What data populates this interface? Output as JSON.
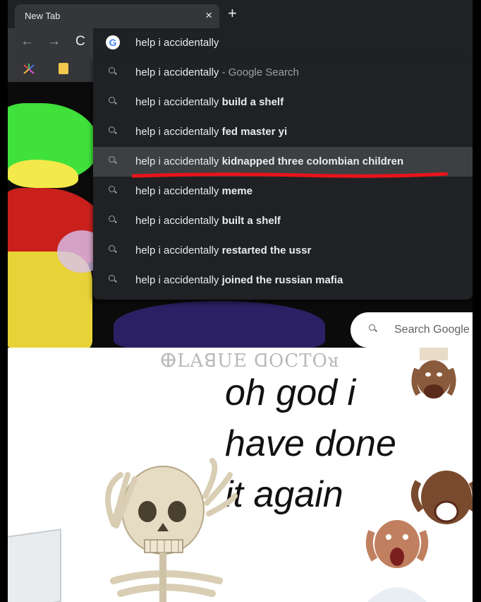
{
  "browser": {
    "tab_title": "New Tab",
    "tab_close": "×",
    "new_tab": "+",
    "nav_back": "←",
    "nav_forward": "→",
    "nav_reload": "C",
    "omnibox_value": "help i accidentally",
    "suggestions": [
      {
        "prefix": "help i accidentally",
        "bold": "",
        "suffix": " - Google Search"
      },
      {
        "prefix": "help i accidentally ",
        "bold": "build a shelf",
        "suffix": ""
      },
      {
        "prefix": "help i accidentally ",
        "bold": "fed master yi",
        "suffix": ""
      },
      {
        "prefix": "help i accidentally ",
        "bold": "kidnapped three colombian children",
        "suffix": ""
      },
      {
        "prefix": "help i accidentally ",
        "bold": "meme",
        "suffix": ""
      },
      {
        "prefix": "help i accidentally ",
        "bold": "built a shelf",
        "suffix": ""
      },
      {
        "prefix": "help i accidentally ",
        "bold": "restarted the ussr",
        "suffix": ""
      },
      {
        "prefix": "help i accidentally ",
        "bold": "joined the russian mafia",
        "suffix": ""
      }
    ],
    "selected_index": 3,
    "search_placeholder": "Search Google"
  },
  "meme": {
    "watermark": "ⴲLAꓭUE ꓷOCTOᴚ",
    "caption": [
      "oh god i",
      "have done",
      "it again"
    ]
  },
  "colors": {
    "dark_bg": "#202124",
    "toolbar": "#35363a",
    "underline": "#e8141b"
  }
}
